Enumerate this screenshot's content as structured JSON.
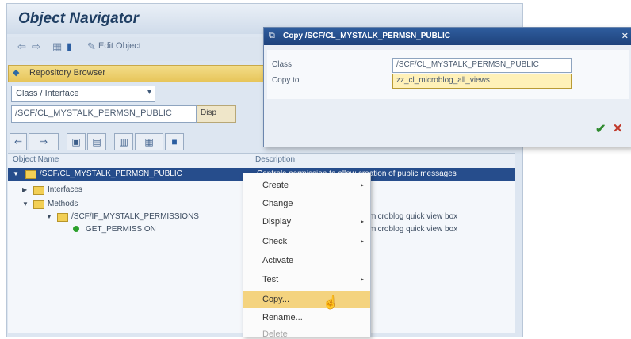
{
  "window": {
    "title": "Object Navigator"
  },
  "toolbar": {
    "nav_back": "⇦",
    "nav_fwd": "⇨",
    "tool1": "▦",
    "tool2": "▮",
    "edit_object_label": "Edit Object"
  },
  "repository": {
    "title": "Repository Browser",
    "type_select": "Class / Interface",
    "object_value": "/SCF/CL_MYSTALK_PERMSN_PUBLIC",
    "display_button": "Disp"
  },
  "tree_toolbar": [
    "⇐",
    "⇒",
    "▣",
    "▤",
    "▥",
    "▦",
    "■"
  ],
  "columns": {
    "name": "Object Name",
    "desc": "Description"
  },
  "tree": [
    {
      "name": "/SCF/CL_MYSTALK_PERMSN_PUBLIC",
      "desc": "Controls permission to allow creation of public messages"
    },
    {
      "name": "Interfaces",
      "desc": ""
    },
    {
      "name": "Methods",
      "desc": ""
    },
    {
      "name": "/SCF/IF_MYSTALK_PERMISSIONS",
      "desc": "microblog quick view box"
    },
    {
      "name": "GET_PERMISSION",
      "desc": "microblog quick view box"
    }
  ],
  "context_menu": [
    {
      "label": "Create",
      "sub": "▸"
    },
    {
      "label": "Change",
      "sub": ""
    },
    {
      "label": "Display",
      "sub": "▸"
    },
    {
      "label": "Check",
      "sub": "▸"
    },
    {
      "label": "Activate",
      "sub": ""
    },
    {
      "label": "Test",
      "sub": "▸"
    },
    {
      "label": "Copy...",
      "sub": ""
    },
    {
      "label": "Rename...",
      "sub": ""
    },
    {
      "label": "Delete",
      "sub": ""
    }
  ],
  "dialog": {
    "title": "Copy /SCF/CL_MYSTALK_PERMSN_PUBLIC",
    "class_label": "Class",
    "class_value": "/SCF/CL_MYSTALK_PERMSN_PUBLIC",
    "copy_to_label": "Copy to",
    "copy_to_value": "zz_cl_microblog_all_views",
    "ok": "✔",
    "cancel": "✕"
  }
}
